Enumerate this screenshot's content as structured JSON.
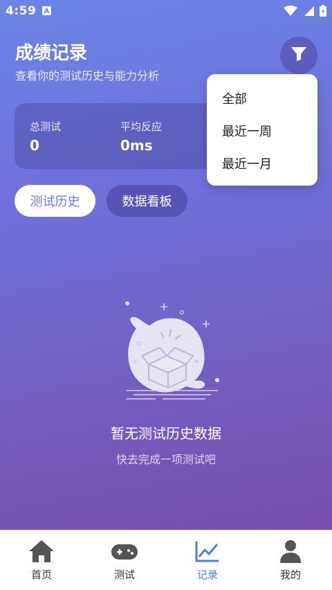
{
  "status_bar": {
    "time": "4:59",
    "icons": [
      "a-notification-icon",
      "wifi-icon",
      "signal-icon",
      "battery-icon"
    ]
  },
  "header": {
    "title": "成绩记录",
    "subtitle": "查看你的测试历史与能力分析",
    "filter_icon": "filter-icon"
  },
  "stats": {
    "total_tests_label": "总测试",
    "total_tests_value": "0",
    "avg_reaction_label": "平均反应",
    "avg_reaction_value": "0ms"
  },
  "tabs": {
    "history": "测试历史",
    "dashboard": "数据看板",
    "active": "history"
  },
  "filter_menu": {
    "items": [
      "全部",
      "最近一周",
      "最近一月"
    ]
  },
  "empty_state": {
    "title": "暂无测试历史数据",
    "subtitle": "快去完成一项测试吧",
    "icon": "empty-box-icon"
  },
  "bottom_nav": {
    "items": [
      {
        "label": "首页",
        "icon": "home-icon"
      },
      {
        "label": "测试",
        "icon": "gamepad-icon"
      },
      {
        "label": "记录",
        "icon": "chart-icon"
      },
      {
        "label": "我的",
        "icon": "user-icon"
      }
    ],
    "active_index": 2
  },
  "colors": {
    "gradient_top": "#6b84e6",
    "gradient_bottom": "#7a4aa8",
    "accent": "#4a7be6",
    "tab_active_text": "#6a7be0"
  }
}
